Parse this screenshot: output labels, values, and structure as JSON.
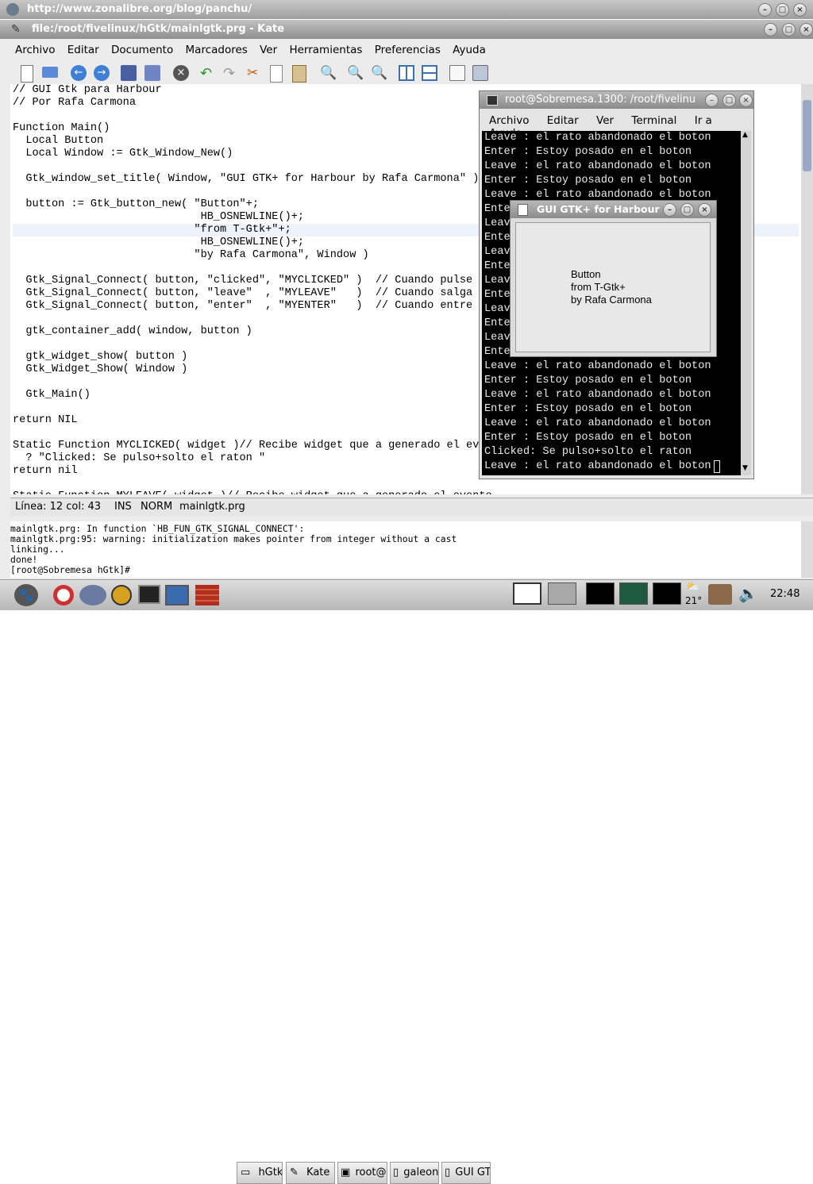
{
  "browser_window": {
    "title": "http://www.zonalibre.org/blog/panchu/"
  },
  "kate": {
    "title": "file:/root/fivelinux/hGtk/mainlgtk.prg - Kate",
    "menu": [
      "Archivo",
      "Editar",
      "Documento",
      "Marcadores",
      "Ver",
      "Herramientas",
      "Preferencias",
      "Ayuda"
    ],
    "toolbar_icons": [
      "new-file-icon",
      "open-folder-icon",
      "back-icon",
      "forward-icon",
      "save-icon",
      "save-as-icon",
      "close-doc-icon",
      "undo-icon",
      "redo-icon",
      "cut-icon",
      "copy-icon",
      "paste-icon",
      "find-icon",
      "find-next-icon",
      "find-prev-icon",
      "split-vertical-icon",
      "split-horizontal-icon",
      "blank-window-icon",
      "print-icon"
    ],
    "code_lines": [
      "// GUI Gtk para Harbour",
      "// Por Rafa Carmona",
      "",
      "Function Main()",
      "  Local Button",
      "  Local Window := Gtk_Window_New()",
      "",
      "  Gtk_window_set_title( Window, \"GUI GTK+ for Harbour by Rafa Carmona\" )",
      "",
      "  button := Gtk_button_new( \"Button\"+;",
      "                             HB_OSNEWLINE()+;",
      "                            \"from T-Gtk+\"+;",
      "                             HB_OSNEWLINE()+;",
      "                            \"by Rafa Carmona\", Window )",
      "",
      "  Gtk_Signal_Connect( button, \"clicked\", \"MYCLICKED\" )  // Cuando pulse +",
      "  Gtk_Signal_Connect( button, \"leave\"  , \"MYLEAVE\"   )  // Cuando salga de",
      "  Gtk_Signal_Connect( button, \"enter\"  , \"MYENTER\"   )  // Cuando entre en",
      "",
      "  gtk_container_add( window, button )",
      "",
      "  gtk_widget_show( button )",
      "  Gtk_Widget_Show( Window )",
      "",
      "  Gtk_Main()",
      "",
      "return NIL",
      "",
      "Static Function MYCLICKED( widget )// Recibe widget que a generado el even",
      "  ? \"Clicked: Se pulso+solto el raton \"",
      "return nil",
      "",
      "Static Function MYLEAVE( widget )// Recibe widget que a generado el evento"
    ],
    "status": {
      "position": "Línea: 12 col: 43",
      "mode1": "INS",
      "mode2": "NORM",
      "filename": "mainlgtk.prg"
    },
    "console_lines": [
      "mainlgtk.prg: In function `HB_FUN_GTK_SIGNAL_CONNECT':",
      "mainlgtk.prg:95: warning: initialization makes pointer from integer without a cast",
      "linking...",
      "done!",
      "[root@Sobremesa hGtk]# "
    ]
  },
  "terminal": {
    "title": "root@Sobremesa.1300: /root/fivelinu",
    "menu": [
      "Archivo",
      "Editar",
      "Ver",
      "Terminal",
      "Ir a",
      "Ayuda"
    ],
    "lines": [
      "Leave : el rato abandonado el boton",
      "Enter : Estoy posado en el boton",
      "Leave : el rato abandonado el boton",
      "Enter : Estoy posado en el boton",
      "Leave : el rato abandonado el boton",
      "Ente",
      "Leav",
      "Ente",
      "Leav",
      "Ente",
      "Leav",
      "Ente",
      "Leav",
      "Ente",
      "Leav",
      "Ente",
      "Leave : el rato abandonado el boton",
      "Enter : Estoy posado en el boton",
      "Leave : el rato abandonado el boton",
      "Enter : Estoy posado en el boton",
      "Leave : el rato abandonado el boton",
      "Enter : Estoy posado en el boton",
      "Clicked: Se pulso+solto el raton",
      "Leave : el rato abandonado el boton "
    ]
  },
  "gtk_window": {
    "title": "GUI GTK+ for Harbour l",
    "button_lines": [
      "Button",
      "from T-Gtk+",
      "by Rafa Carmona"
    ]
  },
  "taskbar": {
    "tasks": [
      "hGtk",
      "Kate",
      "root@S",
      "galeon",
      "GUI GT"
    ],
    "temperature": "21°",
    "clock": "22:48"
  }
}
